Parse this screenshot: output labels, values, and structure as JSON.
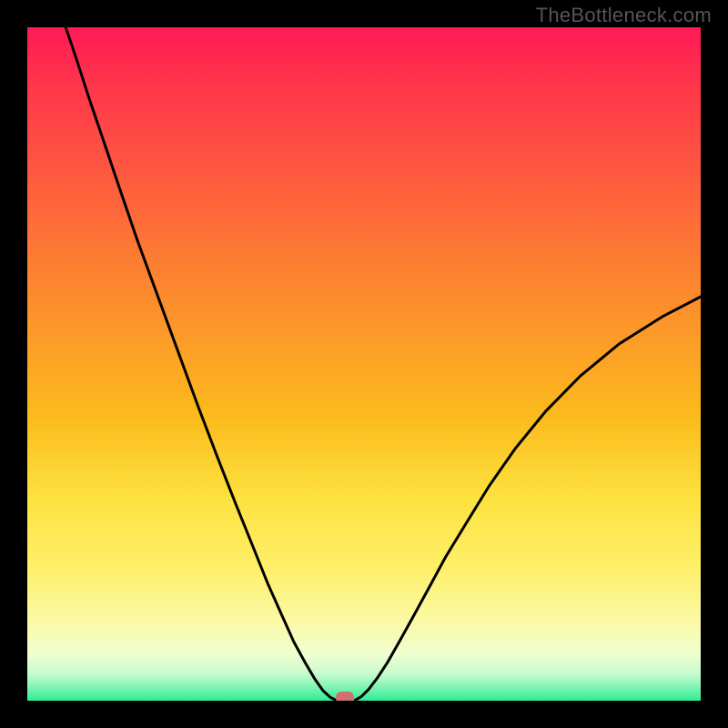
{
  "watermark": "TheBottleneck.com",
  "chart_data": {
    "type": "line",
    "title": "",
    "xlabel": "",
    "ylabel": "",
    "xlim": [
      0,
      100
    ],
    "ylim": [
      0,
      100
    ],
    "grid": false,
    "legend": false,
    "series": {
      "left": [
        {
          "x": 5.7,
          "y": 100.0
        },
        {
          "x": 7.3,
          "y": 95.3
        },
        {
          "x": 9.1,
          "y": 89.7
        },
        {
          "x": 11.2,
          "y": 83.5
        },
        {
          "x": 13.6,
          "y": 76.4
        },
        {
          "x": 16.3,
          "y": 68.5
        },
        {
          "x": 19.3,
          "y": 60.3
        },
        {
          "x": 22.4,
          "y": 51.8
        },
        {
          "x": 25.4,
          "y": 43.6
        },
        {
          "x": 28.3,
          "y": 36.0
        },
        {
          "x": 31.0,
          "y": 29.1
        },
        {
          "x": 33.5,
          "y": 22.9
        },
        {
          "x": 35.7,
          "y": 17.4
        },
        {
          "x": 37.8,
          "y": 12.7
        },
        {
          "x": 39.6,
          "y": 8.7
        },
        {
          "x": 41.3,
          "y": 5.6
        },
        {
          "x": 42.7,
          "y": 3.2
        },
        {
          "x": 43.9,
          "y": 1.5
        },
        {
          "x": 45.0,
          "y": 0.5
        },
        {
          "x": 45.8,
          "y": 0.1
        }
      ],
      "right": [
        {
          "x": 48.7,
          "y": 0.1
        },
        {
          "x": 49.6,
          "y": 0.6
        },
        {
          "x": 50.7,
          "y": 1.7
        },
        {
          "x": 52.0,
          "y": 3.4
        },
        {
          "x": 53.5,
          "y": 5.7
        },
        {
          "x": 55.2,
          "y": 8.7
        },
        {
          "x": 57.2,
          "y": 12.3
        },
        {
          "x": 59.5,
          "y": 16.5
        },
        {
          "x": 62.1,
          "y": 21.3
        },
        {
          "x": 65.2,
          "y": 26.4
        },
        {
          "x": 68.6,
          "y": 31.9
        },
        {
          "x": 72.5,
          "y": 37.5
        },
        {
          "x": 77.0,
          "y": 43.0
        },
        {
          "x": 82.1,
          "y": 48.2
        },
        {
          "x": 87.9,
          "y": 53.0
        },
        {
          "x": 94.4,
          "y": 57.1
        },
        {
          "x": 100.0,
          "y": 60.0
        }
      ]
    },
    "marker": {
      "x": 47.2,
      "y": 0.0,
      "color": "#d0716f"
    },
    "gradient_stops": [
      {
        "pos": 0.0,
        "color": "#ff1a55"
      },
      {
        "pos": 0.5,
        "color": "#fca522"
      },
      {
        "pos": 0.8,
        "color": "#feef68"
      },
      {
        "pos": 1.0,
        "color": "#2dee94"
      }
    ]
  }
}
